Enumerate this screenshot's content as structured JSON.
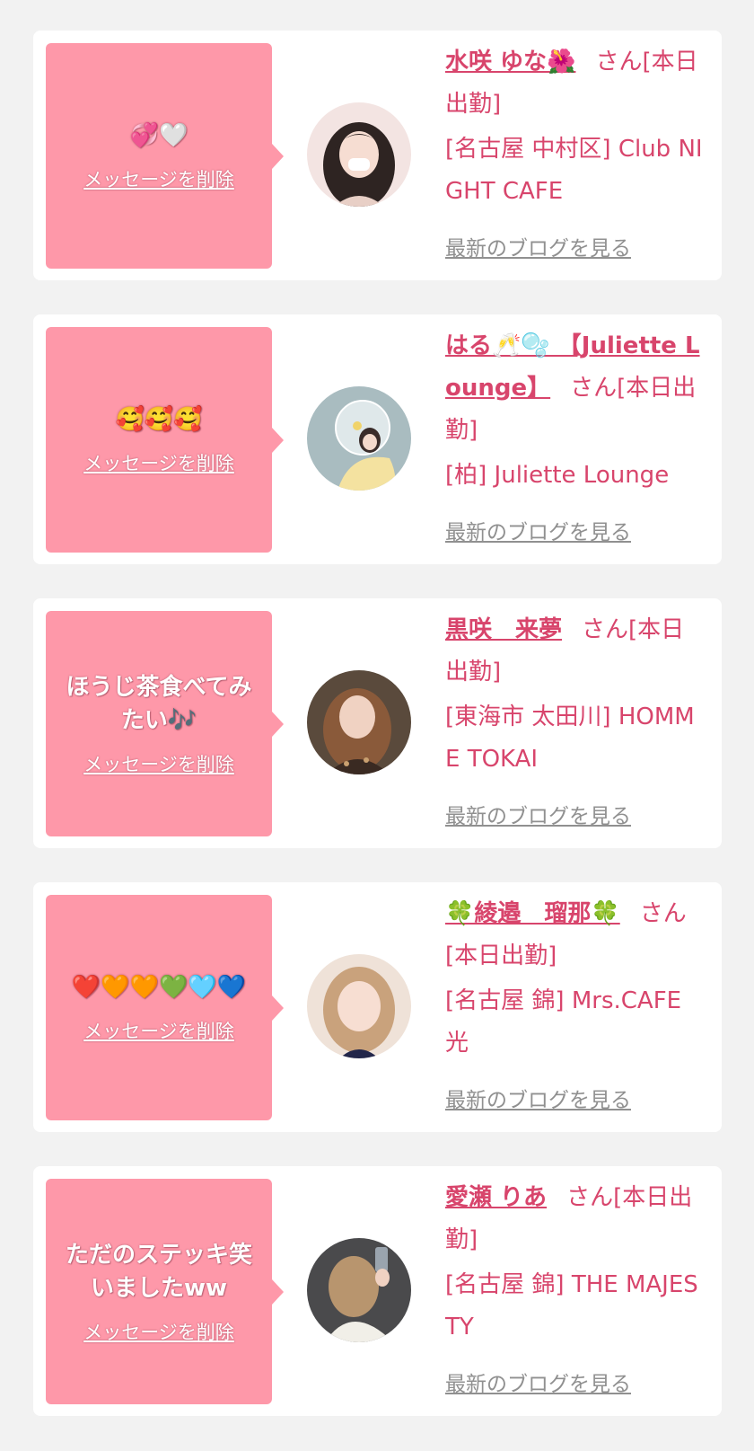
{
  "common": {
    "delete_label": "メッセージを削除",
    "blog_label": "最新のブログを見る"
  },
  "colors": {
    "background": "#f2f2f2",
    "card": "#ffffff",
    "bubble": "#fe98a9",
    "accent_text": "#d8456c",
    "link_gray": "#909090"
  },
  "cards": [
    {
      "message": "💞🤍",
      "name": "水咲 ゆな🌺",
      "status": "さん[本日出勤]",
      "shop": "[名古屋 中村区] Club NIGHT CAFE",
      "avatar": "woman-portrait"
    },
    {
      "message": "🥰🥰🥰",
      "name": "はる🥂🫧 【Juliette Lounge】",
      "status": "さん[本日出勤]",
      "shop": "[柏] Juliette Lounge",
      "avatar": "woman-with-balloon"
    },
    {
      "message": "ほうじ茶食べてみたい🎶",
      "name": "黒咲　来夢",
      "status": "さん[本日出勤]",
      "shop": "[東海市 太田川] HOMME TOKAI",
      "avatar": "woman-portrait"
    },
    {
      "message": "❤️🧡🧡💚🩵💙",
      "name": "🍀綾邉　瑠那🍀",
      "status": "さん[本日出勤]",
      "shop": "[名古屋 錦] Mrs.CAFE 光",
      "avatar": "woman-portrait"
    },
    {
      "message": "ただのステッキ笑いましたww",
      "name": "愛瀬 りあ",
      "status": "さん[本日出勤]",
      "shop": "[名古屋 錦] THE MAJESTY",
      "avatar": "woman-back-view"
    }
  ]
}
